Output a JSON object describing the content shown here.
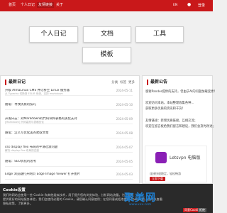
{
  "colors": {
    "brand": "#c9181a",
    "cookie_bg": "#2a2a2a",
    "ad_purple": "#8a1fb5",
    "watermark": "#1f7fd0"
  },
  "nav": {
    "items": [
      "首页",
      "个人日记",
      "友情链接",
      "关于"
    ],
    "lang": "EN",
    "icon": "search-icon",
    "login": "登录"
  },
  "cards": [
    "个人日记",
    "文档",
    "工具",
    "模板"
  ],
  "left_panel": {
    "title": "最新日记",
    "links": [
      "分类",
      "标签",
      "更多"
    ],
    "posts": [
      {
        "title": "升级 AlmaLinux CMS 并迁移至 Linux 服务器",
        "sub": "从 Typecho 切换到 ESLIB 系统，支持 markdown",
        "date": "2024-05-11"
      },
      {
        "title": "随笔：寻找优质的技巧",
        "sub": "",
        "date": "2024-05-10"
      },
      {
        "title": "开发日志：对Markdown的代码块和表格的美化支持",
        "sub": "[Markdown] 代码高亮与表格优化",
        "date": "2024-05-09"
      },
      {
        "title": "随笔：怎么写优化美的爬取文章",
        "sub": "",
        "date": "2024-05-08"
      },
      {
        "title": "css display flex 布局的平滑过渡问题",
        "sub": "解决 display flex 布局的过渡",
        "date": "2024-05-07"
      },
      {
        "title": "随笔：SEO优化的思考",
        "sub": "",
        "date": "2024-05-05"
      },
      {
        "title": "Edge 浏览器打开网页 Edge Image Viewer 打开图片",
        "sub": "",
        "date": "2024-05-03"
      }
    ]
  },
  "right_panel": {
    "title": "最新公告",
    "notices": [
      "感谢Pander提供的支持，但由于AI的问题加载变更！",
      "欢迎访问本站，本站整理收集各种...",
      "获取更多优质的资讯和干货！",
      "友情链接：新增优质链接，互相交流；",
      "欢迎在留言板给我们留言和建议，我们会及时改进；"
    ],
    "ad": {
      "name": "Letsvpn 电脑版",
      "text": "连接快速稳定，轻松畅游",
      "button": "立即下载"
    }
  },
  "cookie": {
    "title": "Cookie设置",
    "lines": [
      "我们的网站会使用一些 Cookie 和其他类似技术，用于提升您的浏览体验，分析网站流量。为了向您",
      "提供更好的网站服务体验，我们会使用必要的 Cookie，请您确认同意使用；在您同意或拒绝使用 Cookie 前，您可以查看",
      "隐私政策，了解更多。"
    ],
    "accept": "同意Cookie",
    "reject": "拒绝"
  },
  "watermark": {
    "main": "聚美网",
    "sub": "www.xxx.com"
  }
}
